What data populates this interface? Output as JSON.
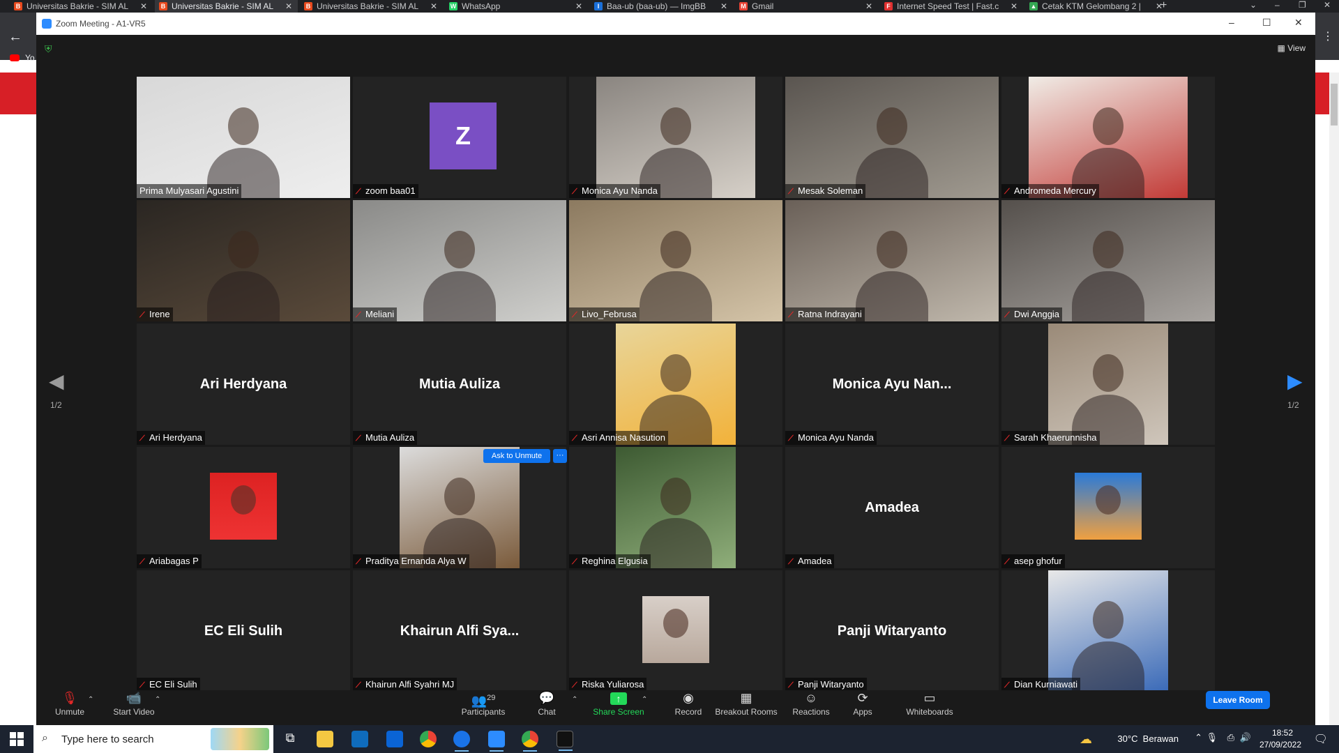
{
  "browser": {
    "tabs": [
      {
        "label": "Universitas Bakrie - SIM AL",
        "fav_color": "#e8491d",
        "fav": "B"
      },
      {
        "label": "Universitas Bakrie - SIM AL",
        "fav_color": "#e8491d",
        "fav": "B",
        "active": true
      },
      {
        "label": "Universitas Bakrie - SIM AL",
        "fav_color": "#e8491d",
        "fav": "B"
      },
      {
        "label": "WhatsApp",
        "fav_color": "#25d366",
        "fav": "W"
      },
      {
        "label": "Baa-ub (baa-ub) — ImgBB",
        "fav_color": "#1a6fd8",
        "fav": "I"
      },
      {
        "label": "Gmail",
        "fav_color": "#ea4335",
        "fav": "M"
      },
      {
        "label": "Internet Speed Test | Fast.c",
        "fav_color": "#e03030",
        "fav": "F"
      },
      {
        "label": "Cetak KTM Gelombang 2 |",
        "fav_color": "#34a853",
        "fav": "▲"
      }
    ],
    "new_tab": "+",
    "bookmark_label": "Yo"
  },
  "zoom": {
    "window_title": "Zoom Meeting - A1-VR5",
    "view_label": "View",
    "page_indicator": "1/2",
    "ask_to_unmute": "Ask to Unmute",
    "more": "···",
    "participants": [
      {
        "name": "Prima Mulyasari Agustini",
        "type": "video",
        "active_speaker": true
      },
      {
        "name": "zoom baa01",
        "type": "avatar-letter",
        "letter": "Z"
      },
      {
        "name": "Monica Ayu Nanda",
        "type": "video"
      },
      {
        "name": "Mesak Soleman",
        "type": "video"
      },
      {
        "name": "Andromeda Mercury",
        "type": "video"
      },
      {
        "name": "Irene",
        "type": "video"
      },
      {
        "name": "Meliani",
        "type": "video"
      },
      {
        "name": "Livo_Februsa",
        "type": "video"
      },
      {
        "name": "Ratna Indrayani",
        "type": "video"
      },
      {
        "name": "Dwi Anggia",
        "type": "video"
      },
      {
        "name": "Ari Herdyana",
        "type": "name-only",
        "big_name": "Ari Herdyana"
      },
      {
        "name": "Mutia Auliza",
        "type": "name-only",
        "big_name": "Mutia Auliza"
      },
      {
        "name": "Asri Annisa Nasution",
        "type": "photo"
      },
      {
        "name": "Monica Ayu Nanda",
        "type": "name-only",
        "big_name": "Monica  Ayu  Nan..."
      },
      {
        "name": "Sarah Khaerunnisha",
        "type": "photo"
      },
      {
        "name": "Ariabagas P",
        "type": "avatar-photo"
      },
      {
        "name": "Praditya Ernanda Alya W",
        "type": "photo"
      },
      {
        "name": "Reghina Elgusia",
        "type": "photo"
      },
      {
        "name": "Amadea",
        "type": "name-only",
        "big_name": "Amadea"
      },
      {
        "name": "asep ghofur",
        "type": "avatar-photo"
      },
      {
        "name": "EC Eli Sulih",
        "type": "name-only",
        "big_name": "EC Eli Sulih"
      },
      {
        "name": "Khairun Alfi Syahri MJ",
        "type": "name-only",
        "big_name": "Khairun  Alfi  Sya..."
      },
      {
        "name": "Riska Yuliarosa",
        "type": "avatar-photo"
      },
      {
        "name": "Panji Witaryanto",
        "type": "name-only",
        "big_name": "Panji Witaryanto"
      },
      {
        "name": "Dian Kurniawati",
        "type": "photo"
      }
    ],
    "toolbar": {
      "unmute": "Unmute",
      "start_video": "Start Video",
      "participants": "Participants",
      "participants_count": "29",
      "chat": "Chat",
      "share_screen": "Share Screen",
      "record": "Record",
      "breakout_rooms": "Breakout Rooms",
      "reactions": "Reactions",
      "apps": "Apps",
      "whiteboards": "Whiteboards",
      "leave_room": "Leave Room"
    },
    "colors": {
      "accent": "#0e72ed",
      "active_speaker": "#f8f269",
      "share_green": "#23d959",
      "muted_red": "#e02828"
    }
  },
  "taskbar": {
    "search_placeholder": "Type here to search",
    "weather": "30°C  Berawan",
    "time": "18:52",
    "date": "27/09/2022"
  }
}
